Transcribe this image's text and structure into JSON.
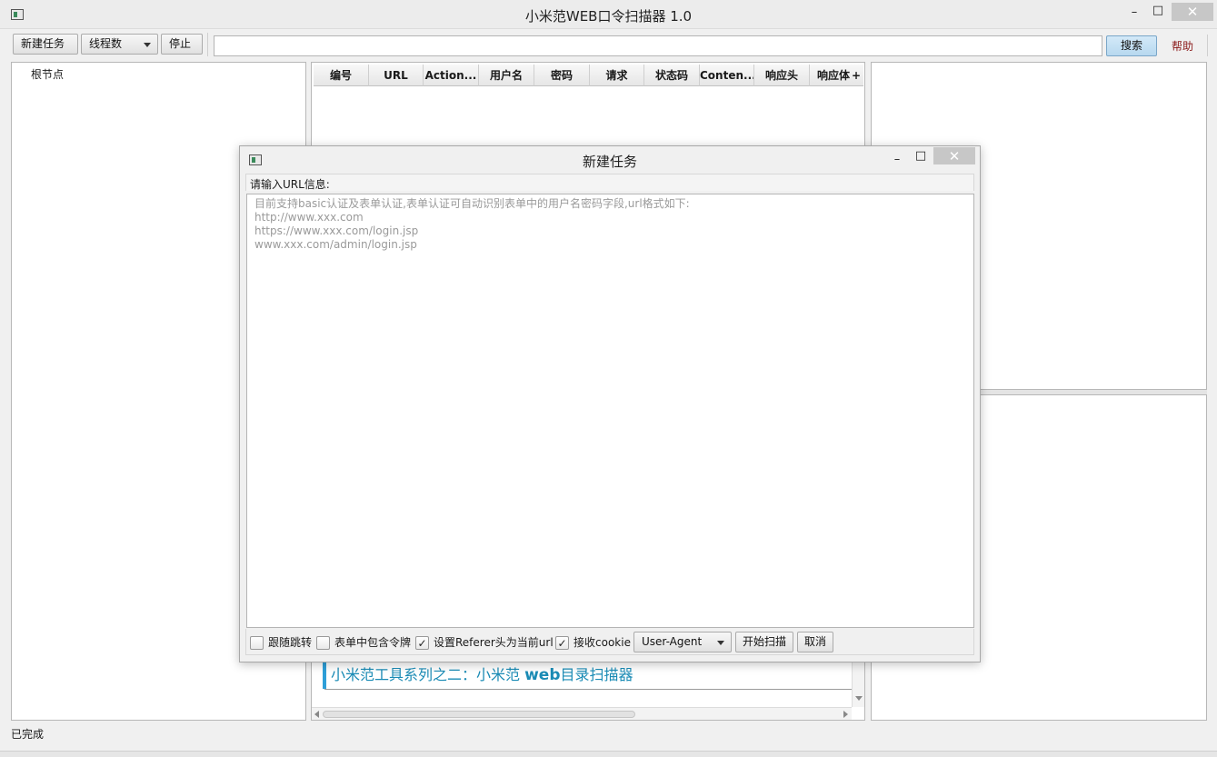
{
  "app": {
    "title": "小米范WEB口令扫描器 1.0",
    "minimize": "–",
    "maximize": "□",
    "close": "✕"
  },
  "toolbar": {
    "new_task": "新建任务",
    "threads": "线程数",
    "stop": "停止",
    "search_value": "",
    "search": "搜索",
    "help": "帮助"
  },
  "tree": {
    "root": "根节点"
  },
  "table": {
    "columns": [
      "编号",
      "URL",
      "Action...",
      "用户名",
      "密码",
      "请求",
      "状态码",
      "Conten...",
      "响应头",
      "响应体",
      "+"
    ]
  },
  "background_text": "小米范工具系列之二：小米范 web目录扫描器",
  "background_text_parts": {
    "prefix": "小米范工具系列之二：小米范 ",
    "bold": "web",
    "suffix": "目录扫描器"
  },
  "status": {
    "text": "已完成"
  },
  "dialog": {
    "title": "新建任务",
    "prompt": "请输入URL信息:",
    "placeholder_lines": [
      "目前支持basic认证及表单认证,表单认证可自动识别表单中的用户名密码字段,url格式如下:",
      "http://www.xxx.com",
      "https://www.xxx.com/login.jsp",
      "www.xxx.com/admin/login.jsp"
    ],
    "options": [
      {
        "label": "跟随跳转",
        "checked": false
      },
      {
        "label": "表单中包含令牌",
        "checked": false
      },
      {
        "label": "设置Referer头为当前url",
        "checked": true
      },
      {
        "label": "接收cookie",
        "checked": true
      }
    ],
    "user_agent": "User-Agent",
    "start": "开始扫描",
    "cancel": "取消"
  },
  "colors": {
    "accent": "#2e9fd8",
    "link_text": "#1a8bb5",
    "help": "#8b1a1a",
    "search_button": "#bcdcf2"
  }
}
